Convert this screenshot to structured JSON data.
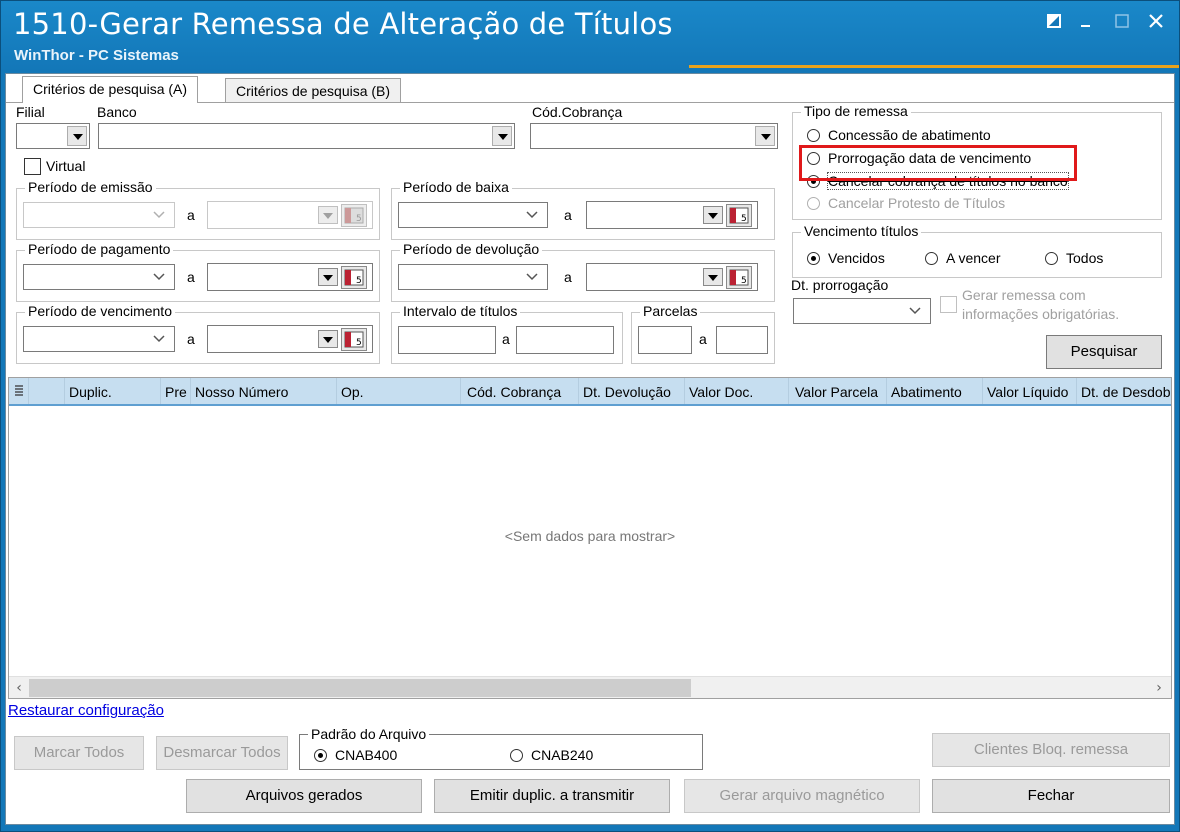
{
  "window": {
    "title": "1510-Gerar Remessa de Alteração de Títulos",
    "subtitle": "WinThor - PC Sistemas"
  },
  "tabs": [
    {
      "label": "Critérios de pesquisa (A)",
      "active": true
    },
    {
      "label": "Critérios de pesquisa (B)",
      "active": false
    }
  ],
  "filters": {
    "filial_label": "Filial",
    "banco_label": "Banco",
    "cod_cobranca_label": "Cód.Cobrança",
    "virtual_label": "Virtual",
    "a_label": "a"
  },
  "periods": {
    "emissao": "Período de emissão",
    "baixa": "Período de baixa",
    "pagamento": "Período de pagamento",
    "devolucao": "Período de devolução",
    "vencimento": "Período de vencimento",
    "intervalo": "Intervalo de títulos",
    "parcelas": "Parcelas"
  },
  "tipo_remessa": {
    "title": "Tipo de remessa",
    "options": [
      {
        "label": "Concessão de abatimento",
        "selected": false,
        "enabled": true
      },
      {
        "label": "Prorrogação data de vencimento",
        "selected": false,
        "enabled": true
      },
      {
        "label": "Cancelar cobrança de títulos no banco",
        "selected": true,
        "enabled": true
      },
      {
        "label": "Cancelar Protesto de Títulos",
        "selected": false,
        "enabled": false
      }
    ]
  },
  "vencimento_titulos": {
    "title": "Vencimento títulos",
    "options": [
      {
        "label": "Vencidos",
        "selected": true
      },
      {
        "label": "A vencer",
        "selected": false
      },
      {
        "label": "Todos",
        "selected": false
      }
    ]
  },
  "dt_prorrogacao_label": "Dt. prorrogação",
  "gerar_remessa_check": {
    "line1": "Gerar remessa com",
    "line2": "informações obrigatórias."
  },
  "buttons": {
    "pesquisar": "Pesquisar",
    "marcar_todos": "Marcar Todos",
    "desmarcar_todos": "Desmarcar Todos",
    "clientes_bloq": "Clientes Bloq. remessa",
    "arquivos_gerados": "Arquivos gerados",
    "emitir_duplic": "Emitir duplic. a transmitir",
    "gerar_arquivo": "Gerar arquivo magnético",
    "fechar": "Fechar"
  },
  "grid": {
    "columns": [
      "Duplic.",
      "Pre",
      "Nosso Número",
      "Op.",
      "Cód. Cobrança",
      "Dt. Devolução",
      "Valor Doc.",
      "Valor Parcela",
      "Abatimento",
      "Valor Líquido",
      "Dt. de Desdobramento"
    ],
    "empty_text": "<Sem dados para mostrar>"
  },
  "restaurar_link": "Restaurar configuração",
  "padrao_arquivo": {
    "title": "Padrão do Arquivo",
    "options": [
      {
        "label": "CNAB400",
        "selected": true
      },
      {
        "label": "CNAB240",
        "selected": false
      }
    ]
  },
  "colors": {
    "titlebar": "#1377b8",
    "grid_header": "#c6def0",
    "highlight": "#e0191a"
  }
}
